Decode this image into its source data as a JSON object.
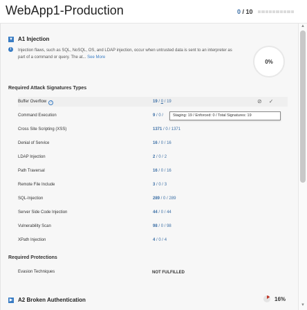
{
  "header": {
    "title": "WebApp1-Production",
    "score_value": "0",
    "score_total": "/ 10"
  },
  "section_a1": {
    "title": "A1 Injection",
    "description": "Injection flaws, such as SQL, NoSQL, OS, and LDAP injection, occur when untrusted data is sent to an interpreter as part of a command or query. The at... ",
    "see_more": "See More",
    "percent": "0%",
    "signatures_label": "Required Attack Signatures Types",
    "rows": [
      {
        "name": "Buffer Overflow",
        "a": "19",
        "b": "0",
        "c": "19"
      },
      {
        "name": "Command Execution",
        "a": "9",
        "b": "0",
        "c": ""
      },
      {
        "name": "Cross Site Scripting (XSS)",
        "a": "1371",
        "b": "0",
        "c": "1371"
      },
      {
        "name": "Denial of Service",
        "a": "16",
        "b": "0",
        "c": "16"
      },
      {
        "name": "LDAP Injection",
        "a": "2",
        "b": "0",
        "c": "2"
      },
      {
        "name": "Path Traversal",
        "a": "16",
        "b": "0",
        "c": "16"
      },
      {
        "name": "Remote File Include",
        "a": "3",
        "b": "0",
        "c": "3"
      },
      {
        "name": "SQL-Injection",
        "a": "289",
        "b": "0",
        "c": "289"
      },
      {
        "name": "Server Side Code Injection",
        "a": "44",
        "b": "0",
        "c": "44"
      },
      {
        "name": "Vulnerability Scan",
        "a": "98",
        "b": "0",
        "c": "98"
      },
      {
        "name": "XPath Injection",
        "a": "4",
        "b": "0",
        "c": "4"
      }
    ],
    "tooltip": "Staging: 19 / Enforced: 0 / Total Signatures: 19",
    "protections_label": "Required Protections",
    "protections": [
      {
        "name": "Evasion Techniques",
        "status": "NOT FULFILLED"
      }
    ]
  },
  "section_a2": {
    "title": "A2 Broken Authentication",
    "percent": "16%",
    "progress": 0.16
  },
  "colors": {
    "accent": "#3a7dc4",
    "value_blue": "#3a6ea5",
    "alert_red": "#c0392b"
  },
  "icons": {
    "block": "block-icon",
    "check": "checkmark-icon",
    "info": "info-icon",
    "help": "help-icon",
    "collapse": "chevron-down-icon"
  }
}
